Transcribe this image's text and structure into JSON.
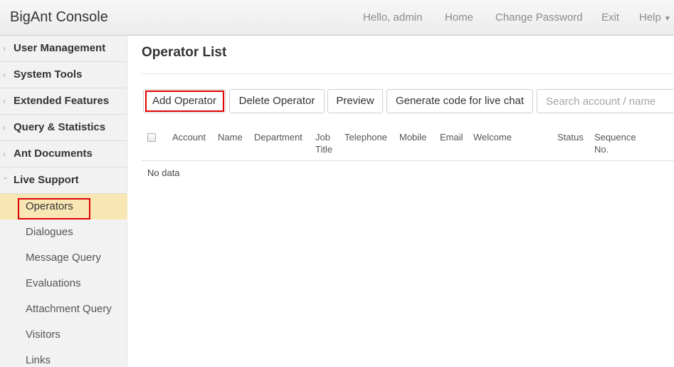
{
  "header": {
    "brand": "BigAnt Console",
    "greeting": "Hello, admin",
    "home": "Home",
    "change_password": "Change Password",
    "exit": "Exit",
    "help": "Help"
  },
  "sidebar": {
    "sections": [
      {
        "label": "User Management"
      },
      {
        "label": "System Tools"
      },
      {
        "label": "Extended Features"
      },
      {
        "label": "Query & Statistics"
      },
      {
        "label": "Ant Documents"
      },
      {
        "label": "Live Support"
      }
    ],
    "live_support_items": [
      {
        "label": "Operators",
        "active": true
      },
      {
        "label": "Dialogues"
      },
      {
        "label": "Message Query"
      },
      {
        "label": "Evaluations"
      },
      {
        "label": "Attachment Query"
      },
      {
        "label": "Visitors"
      },
      {
        "label": "Links"
      }
    ]
  },
  "main": {
    "title": "Operator List",
    "toolbar": {
      "add": "Add Operator",
      "delete": "Delete Operator",
      "preview": "Preview",
      "generate": "Generate code for live chat",
      "search_placeholder": "Search account / name"
    },
    "table": {
      "columns": [
        "Account",
        "Name",
        "Department",
        "Job Title",
        "Telephone",
        "Mobile",
        "Email",
        "Welcome",
        "Status",
        "Sequence No."
      ],
      "empty_text": "No data"
    }
  },
  "colors": {
    "active_menu_bg": "#f8e7b5",
    "highlight_box": "#e00000"
  }
}
